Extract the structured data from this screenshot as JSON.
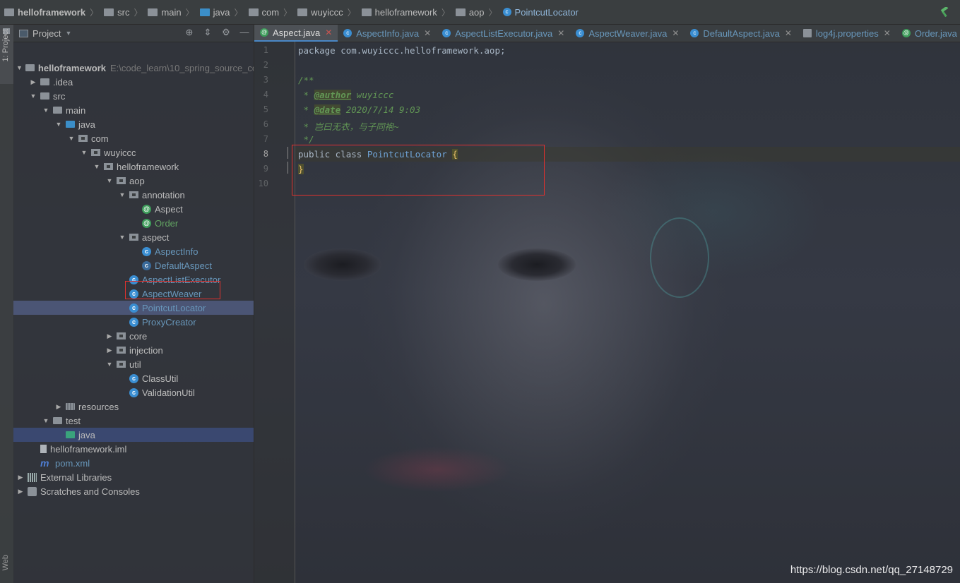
{
  "navbar": {
    "crumbs": [
      "helloframework",
      "src",
      "main",
      "java",
      "com",
      "wuyiccc",
      "helloframework",
      "aop",
      "PointcutLocator"
    ]
  },
  "toolstrip": {
    "project_label": "1: Project",
    "web_label": "Web"
  },
  "project": {
    "title": "Project",
    "root_path": "E:\\code_learn\\10_spring_source_co",
    "tree": [
      {
        "label": "helloframework",
        "depth": 0,
        "arrow": "down",
        "icon": "folder"
      },
      {
        "label": ".idea",
        "depth": 1,
        "arrow": "right",
        "icon": "folder"
      },
      {
        "label": "src",
        "depth": 1,
        "arrow": "down",
        "icon": "folder"
      },
      {
        "label": "main",
        "depth": 2,
        "arrow": "down",
        "icon": "folder"
      },
      {
        "label": "java",
        "depth": 3,
        "arrow": "down",
        "icon": "folder-src"
      },
      {
        "label": "com",
        "depth": 4,
        "arrow": "down",
        "icon": "package"
      },
      {
        "label": "wuyiccc",
        "depth": 5,
        "arrow": "down",
        "icon": "package"
      },
      {
        "label": "helloframework",
        "depth": 6,
        "arrow": "down",
        "icon": "package"
      },
      {
        "label": "aop",
        "depth": 7,
        "arrow": "down",
        "icon": "package"
      },
      {
        "label": "annotation",
        "depth": 8,
        "arrow": "down",
        "icon": "package"
      },
      {
        "label": "Aspect",
        "depth": 9,
        "arrow": "none",
        "icon": "annotation"
      },
      {
        "label": "Order",
        "depth": 9,
        "arrow": "none",
        "icon": "annotation",
        "color": "green"
      },
      {
        "label": "aspect",
        "depth": 8,
        "arrow": "down",
        "icon": "package"
      },
      {
        "label": "AspectInfo",
        "depth": 9,
        "arrow": "none",
        "icon": "class",
        "color": "blue"
      },
      {
        "label": "DefaultAspect",
        "depth": 9,
        "arrow": "none",
        "icon": "abstract-class",
        "color": "blue"
      },
      {
        "label": "AspectListExecutor",
        "depth": 8,
        "arrow": "none",
        "icon": "class",
        "color": "blue"
      },
      {
        "label": "AspectWeaver",
        "depth": 8,
        "arrow": "none",
        "icon": "class",
        "color": "blue"
      },
      {
        "label": "PointcutLocator",
        "depth": 8,
        "arrow": "none",
        "icon": "class",
        "color": "blue",
        "selected": true
      },
      {
        "label": "ProxyCreator",
        "depth": 8,
        "arrow": "none",
        "icon": "class",
        "color": "blue"
      },
      {
        "label": "core",
        "depth": 7,
        "arrow": "right",
        "icon": "package"
      },
      {
        "label": "injection",
        "depth": 7,
        "arrow": "right",
        "icon": "package"
      },
      {
        "label": "util",
        "depth": 7,
        "arrow": "down",
        "icon": "package"
      },
      {
        "label": "ClassUtil",
        "depth": 8,
        "arrow": "none",
        "icon": "class"
      },
      {
        "label": "ValidationUtil",
        "depth": 8,
        "arrow": "none",
        "icon": "class"
      },
      {
        "label": "resources",
        "depth": 3,
        "arrow": "right",
        "icon": "folder-res"
      },
      {
        "label": "test",
        "depth": 2,
        "arrow": "down",
        "icon": "folder"
      },
      {
        "label": "java",
        "depth": 3,
        "arrow": "none",
        "icon": "folder-test",
        "selected2": true
      },
      {
        "label": "helloframework.iml",
        "depth": 1,
        "arrow": "none",
        "icon": "iml"
      },
      {
        "label": "pom.xml",
        "depth": 1,
        "arrow": "none",
        "icon": "maven",
        "color": "blue"
      },
      {
        "label": "External Libraries",
        "depth": 0,
        "arrow": "right",
        "icon": "library"
      },
      {
        "label": "Scratches and Consoles",
        "depth": 0,
        "arrow": "right",
        "icon": "scratch"
      }
    ]
  },
  "tabs": [
    {
      "label": "Aspect.java",
      "icon": "annotation",
      "active": true
    },
    {
      "label": "AspectInfo.java",
      "icon": "class"
    },
    {
      "label": "AspectListExecutor.java",
      "icon": "class"
    },
    {
      "label": "AspectWeaver.java",
      "icon": "class"
    },
    {
      "label": "DefaultAspect.java",
      "icon": "abstract-class"
    },
    {
      "label": "log4j.properties",
      "icon": "properties"
    },
    {
      "label": "Order.java",
      "icon": "annotation"
    }
  ],
  "editor": {
    "line_numbers": [
      "1",
      "2",
      "3",
      "4",
      "5",
      "6",
      "7",
      "8",
      "9",
      "10"
    ],
    "current_line": "8",
    "code": {
      "l1_kw": "package",
      "l1_pkg": " com.wuyiccc.helloframework.aop;",
      "l3": "/**",
      "l4_pre": " * ",
      "l4_tag": "@author",
      "l4_val": " wuyiccc",
      "l5_pre": " * ",
      "l5_tag": "@date",
      "l5_val": " 2020/7/14 9:03",
      "l6": " * 岂曰无衣，与子同袍~",
      "l7": " */",
      "l8_kw1": "public",
      "l8_kw2": " class ",
      "l8_name": "PointcutLocator",
      "l8_brace": "{",
      "l9_brace": "}"
    }
  },
  "watermark": "https://blog.csdn.net/qq_27148729",
  "colors": {
    "selection": "#4b5575",
    "highlight_box": "#e0312e",
    "keyword": "#cc7832",
    "comment": "#629755"
  }
}
